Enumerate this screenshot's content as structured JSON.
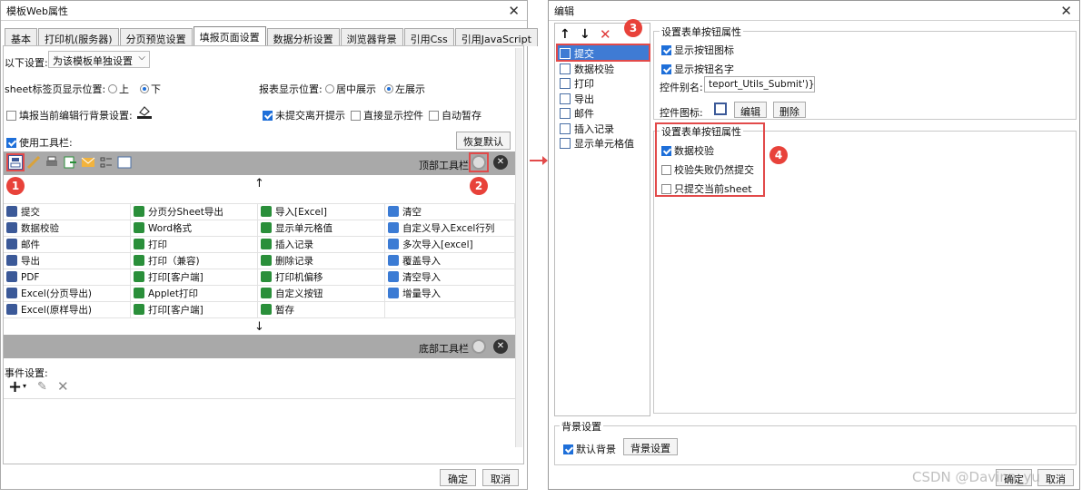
{
  "left": {
    "title": "模板Web属性",
    "tabs": [
      "基本",
      "打印机(服务器)",
      "分页预览设置",
      "填报页面设置",
      "数据分析设置",
      "浏览器背景",
      "引用Css",
      "引用JavaScript"
    ],
    "active_tab": 3,
    "scope_label": "以下设置:",
    "scope_value": "为该模板单独设置",
    "sheet_pos_label": "sheet标签页显示位置:",
    "sheet_pos_top": "上",
    "sheet_pos_bottom": "下",
    "report_pos_label": "报表显示位置:",
    "report_pos_center": "居中展示",
    "report_pos_left": "左展示",
    "fill_bg_label": "填报当前编辑行背景设置:",
    "unsubmitted_label": "未提交离开提示",
    "direct_show_label": "直接显示控件",
    "auto_save_label": "自动暂存",
    "use_toolbar_label": "使用工具栏:",
    "restore_default": "恢复默认",
    "top_toolbar_label": "顶部工具栏",
    "bottom_toolbar_label": "底部工具栏",
    "up_arrow": "↑",
    "down_arrow": "↓",
    "grid": [
      [
        "提交",
        "分页分Sheet导出",
        "导入[Excel]",
        "清空"
      ],
      [
        "数据校验",
        "Word格式",
        "显示单元格值",
        "自定义导入Excel行列"
      ],
      [
        "邮件",
        "打印",
        "插入记录",
        "多次导入[excel]"
      ],
      [
        "导出",
        "打印（兼容)",
        "删除记录",
        "覆盖导入"
      ],
      [
        "PDF",
        "打印[客户端]",
        "打印机偏移",
        "清空导入"
      ],
      [
        "Excel(分页导出)",
        "Applet打印",
        "自定义按钮",
        "增量导入"
      ],
      [
        "Excel(原样导出)",
        "打印[客户端]",
        "暂存",
        ""
      ]
    ],
    "events_label": "事件设置:",
    "ok": "确定",
    "cancel": "取消"
  },
  "right": {
    "title": "编辑",
    "list": [
      "提交",
      "数据校验",
      "打印",
      "导出",
      "邮件",
      "插入记录",
      "显示单元格值"
    ],
    "group1_title": "设置表单按钮属性",
    "show_icon": "显示按钮图标",
    "show_name": "显示按钮名字",
    "alias_label": "控件别名:",
    "alias_value": "teport_Utils_Submit')}",
    "icon_label": "控件图标:",
    "edit_btn": "编辑",
    "delete_btn": "删除",
    "group2_title": "设置表单按钮属性",
    "data_check": "数据校验",
    "check_fail_submit": "校验失败仍然提交",
    "submit_current_sheet": "只提交当前sheet",
    "bg_group_title": "背景设置",
    "default_bg": "默认背景",
    "bg_setting_btn": "背景设置",
    "ok": "确定",
    "cancel": "取消",
    "watermark": "CSDN @Davina_yu"
  },
  "markers": [
    "1",
    "2",
    "3",
    "4"
  ],
  "colors": {
    "accent": "#1e6fd9",
    "marker": "#e8423a",
    "toolbar": "#a9a9a9"
  }
}
